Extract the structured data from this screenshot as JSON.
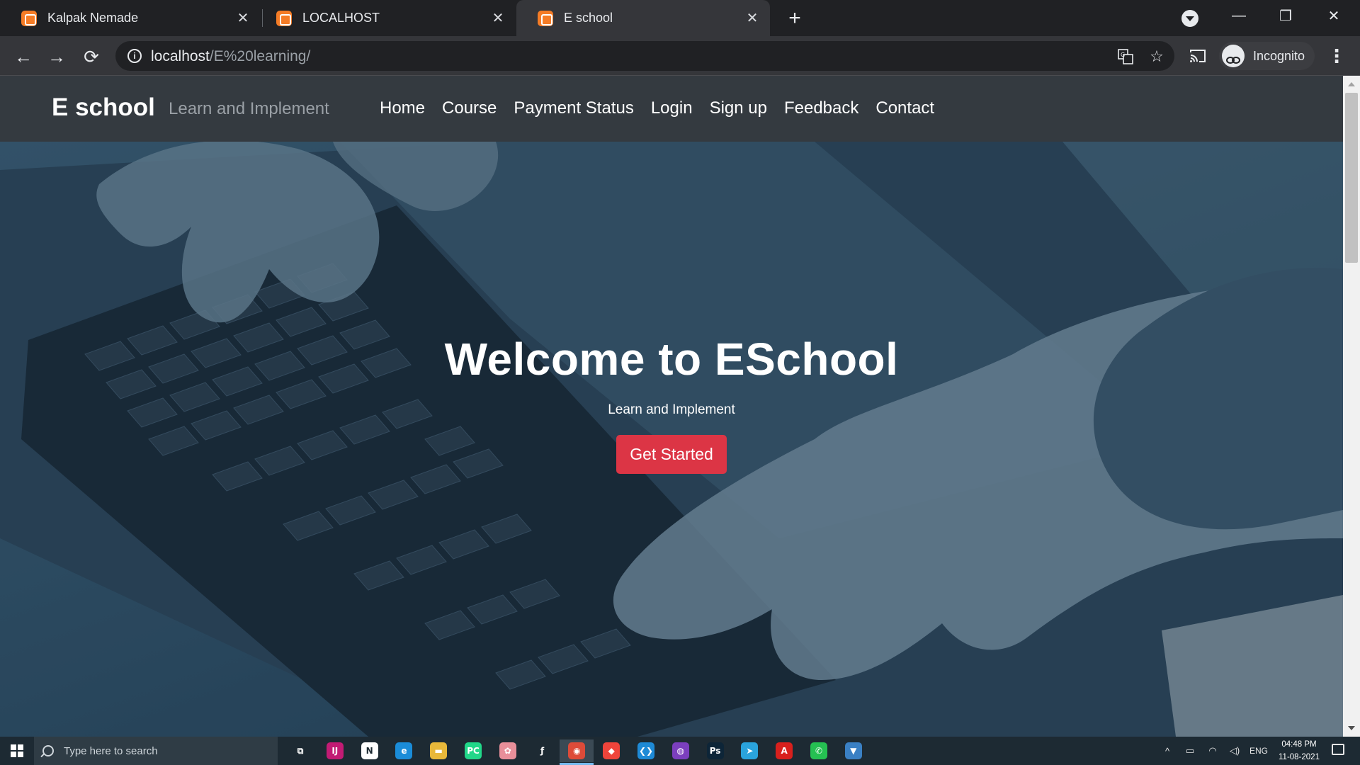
{
  "browser": {
    "tabs": [
      {
        "title": "Kalpak Nemade",
        "active": false
      },
      {
        "title": "LOCALHOST",
        "active": false
      },
      {
        "title": "E school",
        "active": true
      }
    ],
    "new_tab_glyph": "+",
    "close_glyph": "✕",
    "window_controls": {
      "minimize": "—",
      "restore": "❐",
      "close": "✕"
    },
    "nav": {
      "back": "←",
      "forward": "→",
      "reload": "⟳"
    },
    "url_host": "localhost",
    "url_path": "/E%20learning/",
    "profile_label": "Incognito",
    "icons": [
      "info-icon",
      "translate-icon",
      "bookmark-star-icon",
      "cast-icon",
      "incognito-icon",
      "kebab-menu-icon"
    ]
  },
  "site": {
    "brand": "E school",
    "tagline": "Learn and Implement",
    "nav_links": [
      "Home",
      "Course",
      "Payment Status",
      "Login",
      "Sign up",
      "Feedback",
      "Contact"
    ],
    "hero": {
      "title": "Welcome to ESchool",
      "subtitle": "Learn and Implement",
      "button_label": "Get Started",
      "button_color": "#dc3545"
    },
    "colors": {
      "navbar": "#343a40",
      "overlay": "#1d3a52"
    }
  },
  "taskbar": {
    "search_placeholder": "Type here to search",
    "apps": [
      {
        "name": "task-view-icon",
        "glyph": "⧉",
        "color": "transparent"
      },
      {
        "name": "intellij-icon",
        "glyph": "IJ",
        "color": "#c21b74"
      },
      {
        "name": "notion-icon",
        "glyph": "N",
        "color": "#ffffff"
      },
      {
        "name": "edge-icon",
        "glyph": "e",
        "color": "#1a8cd8"
      },
      {
        "name": "file-explorer-icon",
        "glyph": "▬",
        "color": "#e8b83a"
      },
      {
        "name": "pycharm-icon",
        "glyph": "PC",
        "color": "#21d789"
      },
      {
        "name": "brain-app-icon",
        "glyph": "✿",
        "color": "#e88f9a"
      },
      {
        "name": "fl-studio-icon",
        "glyph": "ƒ",
        "color": "transparent"
      },
      {
        "name": "chrome-icon",
        "glyph": "◉",
        "color": "#dd4b39"
      },
      {
        "name": "anydesk-icon",
        "glyph": "◆",
        "color": "#ef443b"
      },
      {
        "name": "vscode-icon",
        "glyph": "❮❯",
        "color": "#1e8ad6"
      },
      {
        "name": "github-desktop-icon",
        "glyph": "◍",
        "color": "#7b3fbe"
      },
      {
        "name": "photoshop-icon",
        "glyph": "Ps",
        "color": "#0d2538"
      },
      {
        "name": "telegram-icon",
        "glyph": "➤",
        "color": "#2aa3dc"
      },
      {
        "name": "acrobat-icon",
        "glyph": "A",
        "color": "#d8201d"
      },
      {
        "name": "whatsapp-icon",
        "glyph": "✆",
        "color": "#25c052"
      },
      {
        "name": "snipping-icon",
        "glyph": "▼",
        "color": "#3a80c4"
      }
    ],
    "tray": {
      "chevron": "^",
      "battery": "▭",
      "wifi": "◠",
      "volume": "◁)",
      "language": "ENG"
    },
    "time": "04:48 PM",
    "date": "11-08-2021"
  }
}
